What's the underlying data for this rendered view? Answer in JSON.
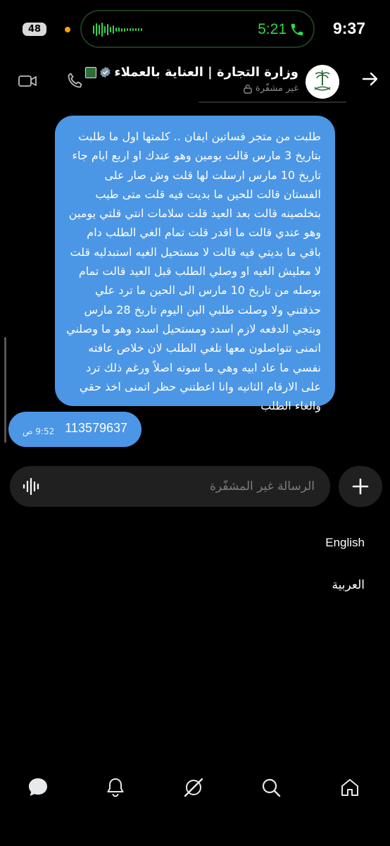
{
  "status_bar": {
    "battery": "48",
    "island_time": "5:21",
    "time": "9:37",
    "icons": [
      "camera-in-use-dot",
      "waveform",
      "phone-call-icon"
    ],
    "colors": {
      "live_activity": "#32d74b",
      "camera_dot": "#ff9f0a"
    }
  },
  "header": {
    "contact_name": "وزارة التجارة | العناية بالعملاء",
    "encryption_status": "غير مشفّرة",
    "icons": [
      "back-arrow-icon",
      "ministry-logo",
      "verified-icon",
      "flag-icon",
      "lock-icon",
      "phone-icon",
      "video-icon"
    ]
  },
  "messages": {
    "long_text": "طلبت من متجر فساتين ايفان .. كلمتها اول ما طلبت بتاريخ 3 مارس قالت يومين وهو عندك او اربع ايام جاء تاريخ 10 مارس ارسلت لها قلت وش صار على الفستان قالت للحين ما بديت فيه قلت متى طيب بتخلصينه قالت بعد العيد قلت سلامات انتي قلتي يومين وهو عندي قالت ما اقدر قلت تمام الغي الطلب دام باقي ما بديتي فيه قالت لا مستحيل الغيه استبدليه قلت لا معليش الغيه او وصلي الطلب قبل العيد قالت تمام بوصله من تاريخ 10 مارس الى الحين ما ترد علي حذفتني ولا وصلت طلبي الين اليوم تاريخ 28 مارس وبتجي الدفعه لازم اسدد ومستحيل اسدد وهو ما وصلني اتمنى تتواصلون معها تلغي الطلب لان خلاص عافته نفسي ما عاد ابيه وهي ما سوته اصلاً ورغم ذلك ترد على الارقام الثانيه وانا اعطتني حظر اتمنى اخذ حقي والغاء الطلب",
    "short_text": "113579637",
    "short_time": "9:52 ص",
    "bubble_color": "#4c96e6"
  },
  "composer": {
    "placeholder": "الرسالة غير المشفّرة",
    "icons": [
      "voice-message-icon",
      "plus-icon"
    ]
  },
  "languages": {
    "english": "English",
    "arabic": "العربية"
  },
  "nav": {
    "icons": [
      "messages-icon",
      "notifications-icon",
      "grok-icon",
      "search-icon",
      "home-icon"
    ]
  }
}
